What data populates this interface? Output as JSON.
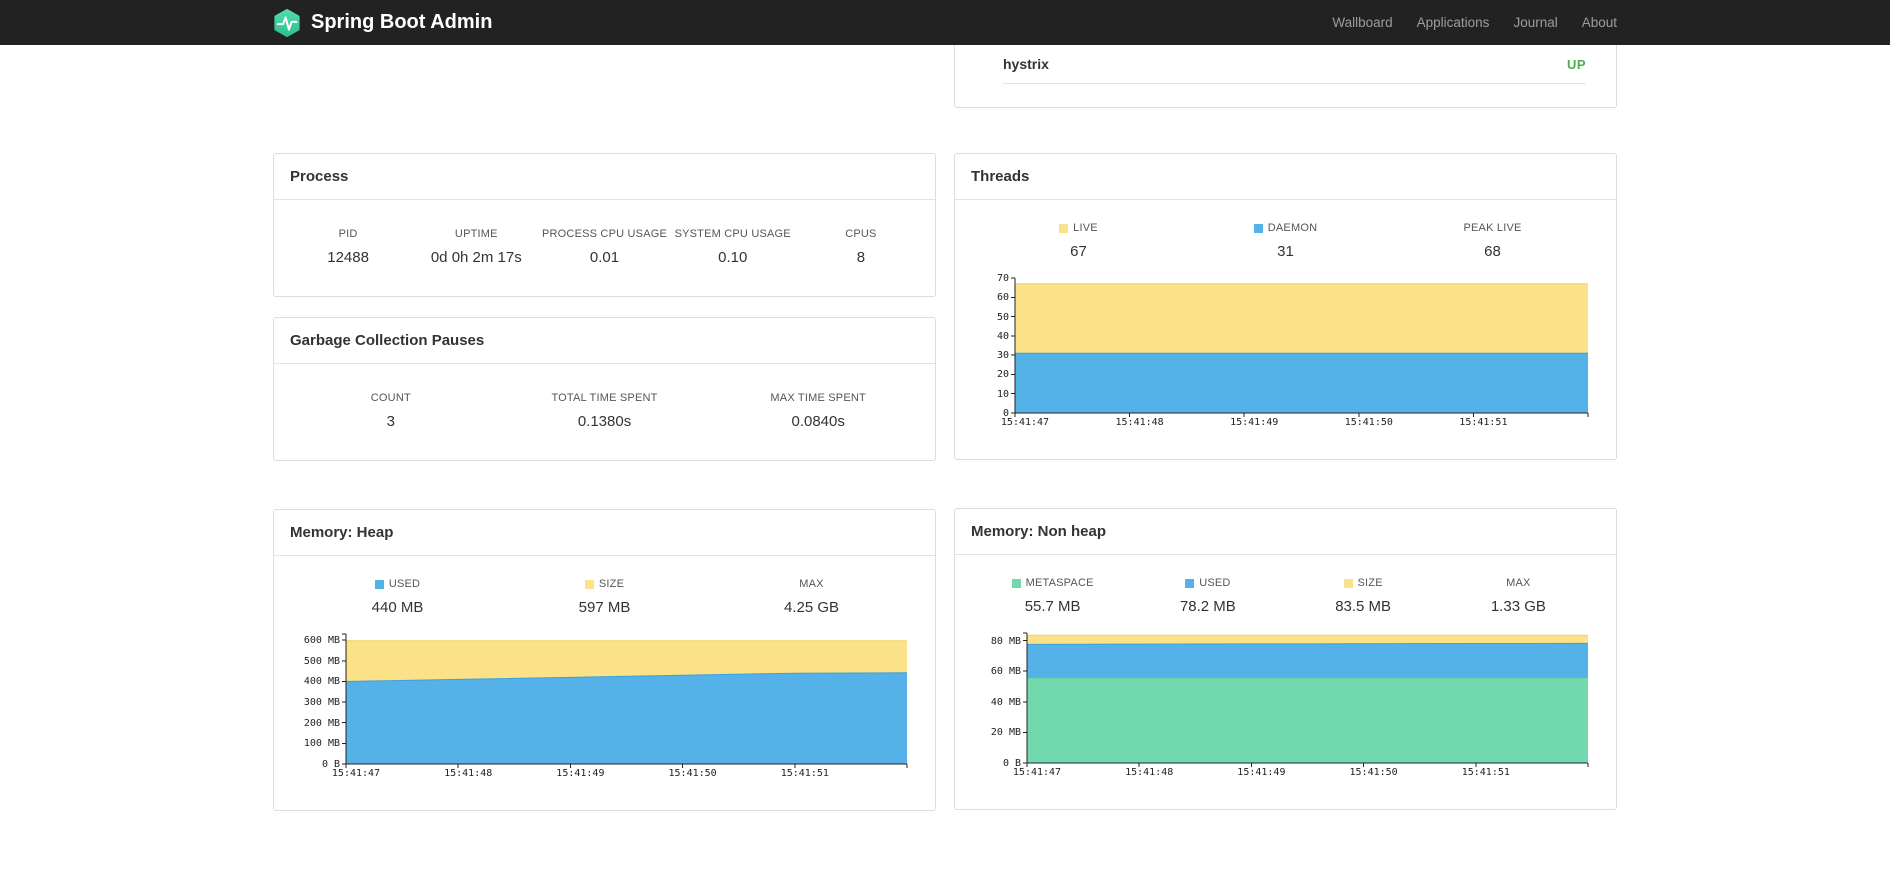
{
  "navbar": {
    "brand": "Spring Boot Admin",
    "links": [
      "Wallboard",
      "Applications",
      "Journal",
      "About"
    ]
  },
  "application": {
    "name": "hystrix",
    "status": "UP",
    "status_color": "#4cae4c"
  },
  "panels": {
    "process": {
      "title": "Process",
      "stats": [
        {
          "label": "PID",
          "value": "12488"
        },
        {
          "label": "UPTIME",
          "value": "0d 0h 2m 17s"
        },
        {
          "label": "PROCESS CPU USAGE",
          "value": "0.01"
        },
        {
          "label": "SYSTEM CPU USAGE",
          "value": "0.10"
        },
        {
          "label": "CPUS",
          "value": "8"
        }
      ]
    },
    "gc": {
      "title": "Garbage Collection Pauses",
      "stats": [
        {
          "label": "COUNT",
          "value": "3"
        },
        {
          "label": "TOTAL TIME SPENT",
          "value": "0.1380s"
        },
        {
          "label": "MAX TIME SPENT",
          "value": "0.0840s"
        }
      ]
    }
  },
  "chart_data": [
    {
      "id": "threads",
      "type": "area",
      "stacked": true,
      "title": "Threads",
      "legend_position": "top",
      "grid": false,
      "x_ticks": [
        "15:41:47",
        "15:41:48",
        "15:41:49",
        "15:41:50",
        "15:41:51"
      ],
      "ylim": [
        0,
        70
      ],
      "y_ticks": [
        {
          "value": 0,
          "label": "0"
        },
        {
          "value": 10,
          "label": "10"
        },
        {
          "value": 20,
          "label": "20"
        },
        {
          "value": 30,
          "label": "30"
        },
        {
          "value": 40,
          "label": "40"
        },
        {
          "value": 50,
          "label": "50"
        },
        {
          "value": 60,
          "label": "60"
        },
        {
          "value": 70,
          "label": "70"
        }
      ],
      "legend": [
        {
          "name": "LIVE",
          "value": "67",
          "color": "#fbe187"
        },
        {
          "name": "DAEMON",
          "value": "31",
          "color": "#55b2e8"
        },
        {
          "name": "PEAK LIVE",
          "value": "68",
          "color": null
        }
      ],
      "series": [
        {
          "name": "DAEMON",
          "color": "#55b2e8",
          "stroke": "#3f9fd8",
          "values": [
            31,
            31,
            31,
            31,
            31,
            31
          ]
        },
        {
          "name": "LIVE",
          "color": "#fbe187",
          "stroke": "#edd264",
          "values": [
            67,
            67,
            67,
            67,
            67,
            67
          ]
        }
      ]
    },
    {
      "id": "heap",
      "type": "area",
      "stacked": true,
      "title": "Memory: Heap",
      "legend_position": "top",
      "grid": false,
      "unit": "MB",
      "x_ticks": [
        "15:41:47",
        "15:41:48",
        "15:41:49",
        "15:41:50",
        "15:41:51"
      ],
      "ylim": [
        0,
        630
      ],
      "y_ticks": [
        {
          "value": 0,
          "label": "0 B"
        },
        {
          "value": 100,
          "label": "100 MB"
        },
        {
          "value": 200,
          "label": "200 MB"
        },
        {
          "value": 300,
          "label": "300 MB"
        },
        {
          "value": 400,
          "label": "400 MB"
        },
        {
          "value": 500,
          "label": "500 MB"
        },
        {
          "value": 600,
          "label": "600 MB"
        }
      ],
      "legend": [
        {
          "name": "USED",
          "value": "440 MB",
          "color": "#55b2e8"
        },
        {
          "name": "SIZE",
          "value": "597 MB",
          "color": "#fbe187"
        },
        {
          "name": "MAX",
          "value": "4.25 GB",
          "color": null
        }
      ],
      "series": [
        {
          "name": "USED",
          "color": "#55b2e8",
          "stroke": "#3f9fd8",
          "values": [
            400,
            410,
            420,
            430,
            440,
            442
          ]
        },
        {
          "name": "SIZE",
          "color": "#fbe187",
          "stroke": "#edd264",
          "values": [
            597,
            597,
            597,
            597,
            597,
            597
          ]
        }
      ]
    },
    {
      "id": "nonheap",
      "type": "area",
      "stacked": true,
      "title": "Memory: Non heap",
      "legend_position": "top",
      "grid": false,
      "unit": "MB",
      "x_ticks": [
        "15:41:47",
        "15:41:48",
        "15:41:49",
        "15:41:50",
        "15:41:51"
      ],
      "ylim": [
        0,
        85
      ],
      "y_ticks": [
        {
          "value": 0,
          "label": "0 B"
        },
        {
          "value": 20,
          "label": "20 MB"
        },
        {
          "value": 40,
          "label": "40 MB"
        },
        {
          "value": 60,
          "label": "60 MB"
        },
        {
          "value": 80,
          "label": "80 MB"
        }
      ],
      "legend": [
        {
          "name": "METASPACE",
          "value": "55.7 MB",
          "color": "#72d9ae"
        },
        {
          "name": "USED",
          "value": "78.2 MB",
          "color": "#55b2e8"
        },
        {
          "name": "SIZE",
          "value": "83.5 MB",
          "color": "#fbe187"
        },
        {
          "name": "MAX",
          "value": "1.33 GB",
          "color": null
        }
      ],
      "series": [
        {
          "name": "METASPACE",
          "color": "#72d9ae",
          "stroke": "#57c79a",
          "values": [
            55.7,
            55.7,
            55.7,
            55.7,
            55.7,
            55.7
          ]
        },
        {
          "name": "USED",
          "color": "#55b2e8",
          "stroke": "#3f9fd8",
          "values": [
            77.6,
            77.7,
            77.9,
            78.0,
            78.1,
            78.2
          ]
        },
        {
          "name": "SIZE",
          "color": "#fbe187",
          "stroke": "#edd264",
          "values": [
            83.5,
            83.5,
            83.5,
            83.5,
            83.5,
            83.5
          ]
        }
      ]
    }
  ]
}
